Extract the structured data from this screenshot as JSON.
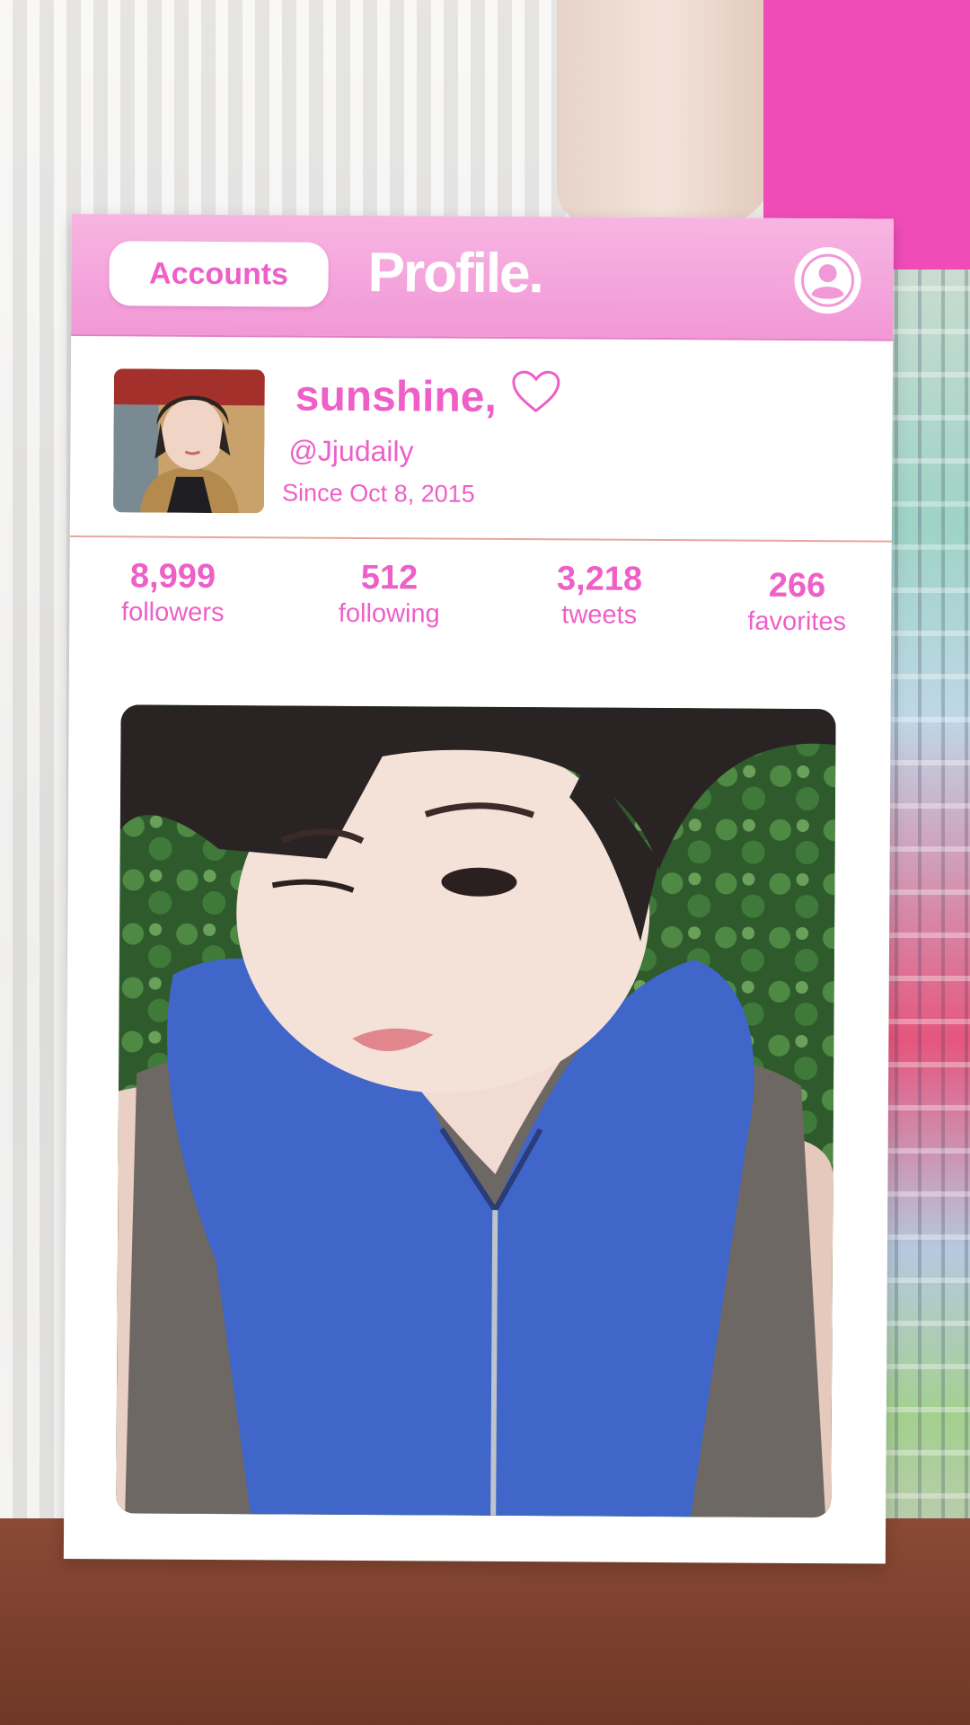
{
  "header": {
    "accounts_label": "Accounts",
    "title": "Profile.",
    "profile_icon": "user-circle-icon"
  },
  "profile": {
    "display_name": "sunshine,",
    "heart_icon": "heart-outline-icon",
    "handle": "@Jjudaily",
    "since": "Since Oct 8, 2015"
  },
  "stats": [
    {
      "value": "8,999",
      "label": "followers"
    },
    {
      "value": "512",
      "label": "following"
    },
    {
      "value": "3,218",
      "label": "tweets"
    },
    {
      "value": "266",
      "label": "favorites"
    }
  ],
  "colors": {
    "accent": "#ee5fc8",
    "header_bg": "#f4a9dd",
    "card_bg": "#ffffff"
  }
}
